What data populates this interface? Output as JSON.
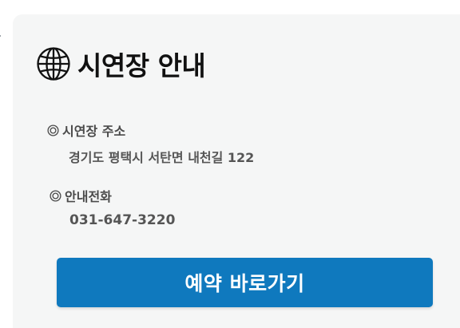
{
  "section": {
    "icon": "globe-icon",
    "title": "시연장 안내"
  },
  "address": {
    "icon": "double-circle-icon",
    "label": "시연장 주소",
    "value": "경기도 평택시 서탄면 내천길 122"
  },
  "phone": {
    "icon": "double-circle-icon",
    "label": "안내전화",
    "value": "031-647-3220"
  },
  "reserve_button": {
    "label": "예약 바로가기"
  },
  "colors": {
    "card_background": "#f5f6f6",
    "button_background": "#0f79be",
    "button_text": "#ffffff",
    "title_text": "#111111",
    "body_text": "#555555"
  }
}
